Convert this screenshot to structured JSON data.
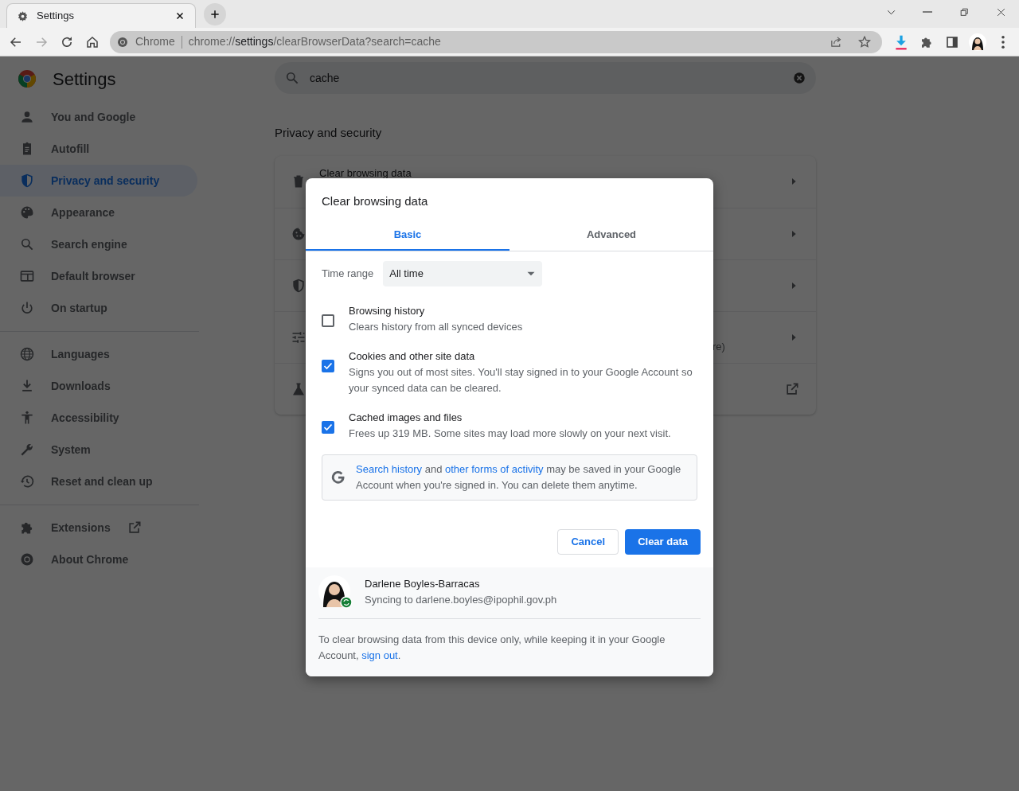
{
  "browser": {
    "tab_title": "Settings",
    "address": {
      "origin_label": "Chrome",
      "url_scheme": "chrome://",
      "url_host": "settings",
      "url_path": "/clearBrowserData?search=cache"
    }
  },
  "sidebar": {
    "title": "Settings",
    "groups": [
      {
        "items": [
          {
            "label": "You and Google",
            "selected": false
          },
          {
            "label": "Autofill",
            "selected": false
          },
          {
            "label": "Privacy and security",
            "selected": true
          },
          {
            "label": "Appearance",
            "selected": false
          },
          {
            "label": "Search engine",
            "selected": false
          },
          {
            "label": "Default browser",
            "selected": false
          },
          {
            "label": "On startup",
            "selected": false
          }
        ]
      },
      {
        "items": [
          {
            "label": "Languages",
            "selected": false
          },
          {
            "label": "Downloads",
            "selected": false
          },
          {
            "label": "Accessibility",
            "selected": false
          },
          {
            "label": "System",
            "selected": false
          },
          {
            "label": "Reset and clean up",
            "selected": false
          }
        ]
      },
      {
        "items": [
          {
            "label": "Extensions",
            "selected": false,
            "kind": "external"
          },
          {
            "label": "About Chrome",
            "selected": false,
            "kind": "page"
          }
        ]
      }
    ]
  },
  "search": {
    "value": "cache"
  },
  "section": {
    "heading": "Privacy and security",
    "rows": [
      {
        "kind": "subpage",
        "text": "Clear browsing data"
      },
      {
        "kind": "subpage"
      },
      {
        "kind": "subpage"
      },
      {
        "kind": "subpage",
        "text_tail": "re)"
      },
      {
        "kind": "external"
      }
    ]
  },
  "dialog": {
    "title": "Clear browsing data",
    "tabs": [
      {
        "label": "Basic",
        "selected": true
      },
      {
        "label": "Advanced",
        "selected": false
      }
    ],
    "time_range": {
      "label": "Time range",
      "value": "All time"
    },
    "items": [
      {
        "title": "Browsing history",
        "description": "Clears history from all synced devices",
        "checked": false
      },
      {
        "title": "Cookies and other site data",
        "description": "Signs you out of most sites. You'll stay signed in to your Google Account so your synced data can be cleared.",
        "checked": true
      },
      {
        "title": "Cached images and files",
        "description": "Frees up 319 MB. Some sites may load more slowly on your next visit.",
        "checked": true
      }
    ],
    "info": [
      {
        "text": "Search history",
        "link": true
      },
      {
        "text": " and ",
        "link": false
      },
      {
        "text": "other forms of activity",
        "link": true
      },
      {
        "text": " may be saved in your Google Account when you're signed in. You can delete them anytime.",
        "link": false
      }
    ],
    "buttons": {
      "cancel": "Cancel",
      "confirm": "Clear data"
    },
    "account": {
      "name": "Darlene Boyles-Barracas",
      "status": "Syncing to darlene.boyles@ipophil.gov.ph"
    },
    "footer": {
      "text": "To clear browsing data from this device only, while keeping it in your Google Account, ",
      "link": "sign out",
      "end": "."
    }
  }
}
